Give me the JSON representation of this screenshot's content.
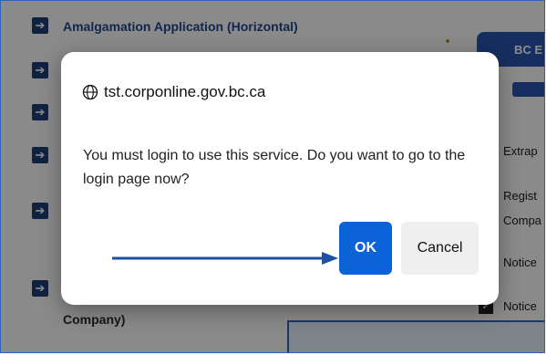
{
  "background": {
    "links": [
      {
        "label": "Amalgamation Application (Horizontal)"
      },
      {
        "label": ""
      },
      {
        "label": ""
      },
      {
        "label": ""
      },
      {
        "label": ""
      },
      {
        "label": ""
      }
    ],
    "company_fragment": "Company)",
    "right_tab": "BC E",
    "right_items": [
      "Extrap",
      "Regist",
      "Compa",
      "Notice",
      "Notice"
    ]
  },
  "dialog": {
    "host": "tst.corponline.gov.bc.ca",
    "message": "You must login to use this service.  Do you want to go to the login page now?",
    "ok_label": "OK",
    "cancel_label": "Cancel"
  },
  "icons": {
    "globe": "globe-icon",
    "arrow": "arrow-right-icon",
    "pointer": "pointer-arrow-icon"
  },
  "colors": {
    "accent": "#0b63d7",
    "annotation": "#1f4fa3",
    "link": "#23458c"
  }
}
